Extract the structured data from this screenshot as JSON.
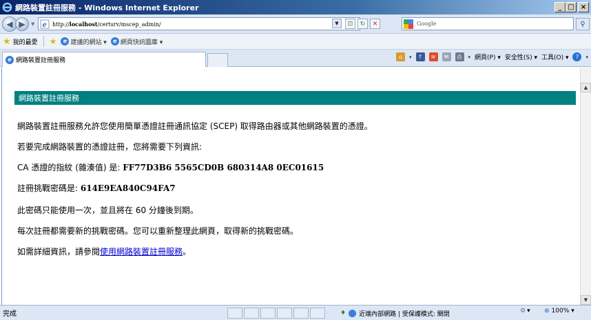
{
  "window": {
    "title": "網路裝置註冊服務 - Windows Internet Explorer",
    "minimize_glyph": "_",
    "maximize_glyph": "□",
    "close_glyph": "×"
  },
  "address": {
    "url_prefix": "http://",
    "url_host": "localhost",
    "url_path": "/certsrv/mscep_admin/",
    "search_placeholder": "Google"
  },
  "favorites": {
    "label": "我的最愛",
    "links": [
      {
        "label": "建議的網站 ▾"
      },
      {
        "label": "網頁快訊圖庫 ▾"
      }
    ]
  },
  "tabs": [
    {
      "label": "網路裝置註冊服務"
    }
  ],
  "commandbar": {
    "page_menu": "網頁(P) ▾",
    "safety_menu": "安全性(S) ▾",
    "tools_menu": "工具(O) ▾"
  },
  "content": {
    "header": "網路裝置註冊服務",
    "intro": "網路裝置註冊服務允許您使用簡單憑證註冊通訊協定 (SCEP) 取得路由器或其他網路裝置的憑證。",
    "need_info": "若要完成網路裝置的憑證註冊，您將需要下列資訊:",
    "thumbprint_label": "CA 憑證的指紋 (雜湊值) 是: ",
    "thumbprint_value": "FF77D3B6 5565CD0B 680314A8 0EC01615",
    "challenge_label": "註冊挑戰密碼是: ",
    "challenge_value": "614E9EA840C94FA7",
    "one_time": "此密碼只能使用一次，並且將在 60 分鐘後到期。",
    "each_time": "每次註冊都需要新的挑戰密碼。您可以重新整理此網頁，取得新的挑戰密碼。",
    "more_info_prefix": "如需詳細資訊，請參閱",
    "more_info_link": "使用網路裝置註冊服務",
    "more_info_suffix": "。"
  },
  "status": {
    "text": "完成",
    "zone": "近端內部網路 | 受保護模式: 關閉",
    "zoom": "100%"
  }
}
